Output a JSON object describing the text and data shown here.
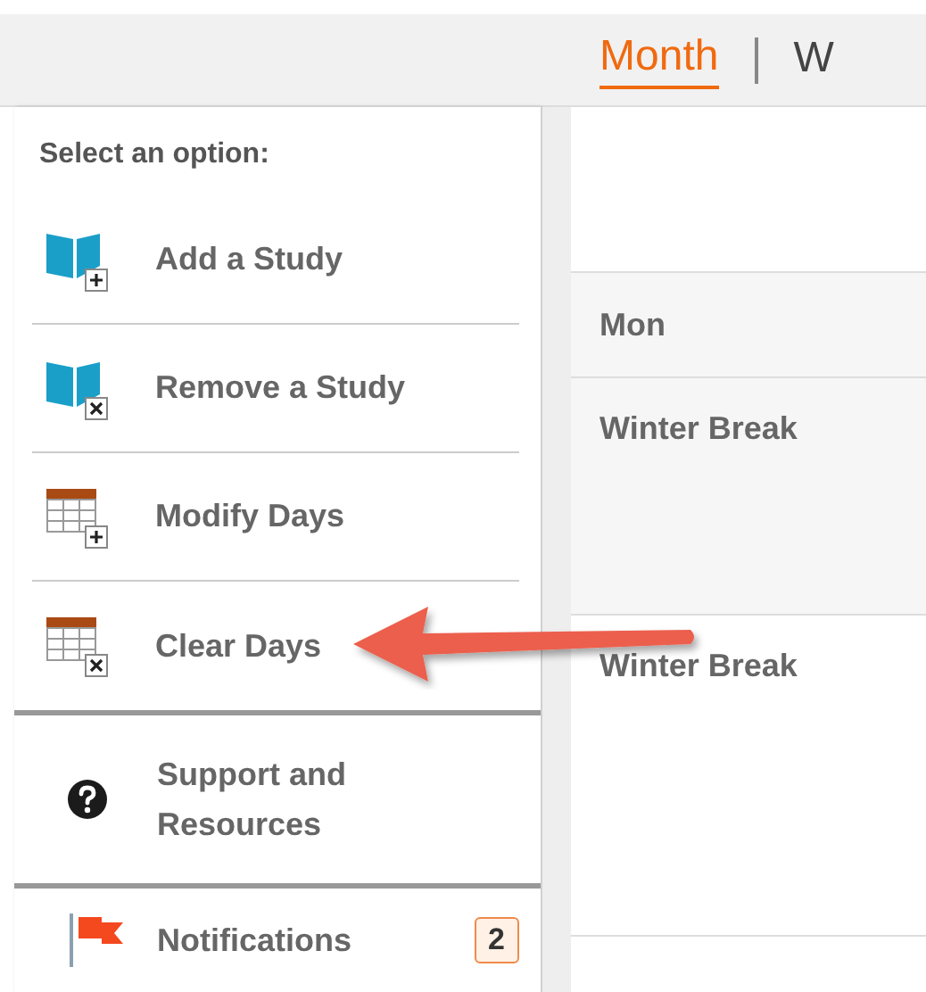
{
  "view_tabs": [
    {
      "label": "Month",
      "selected": true
    },
    {
      "label": "W",
      "selected": false
    }
  ],
  "sidebar": {
    "heading": "Select an option:",
    "items": [
      {
        "kind": "book-add",
        "label": "Add a Study"
      },
      {
        "kind": "book-remove",
        "label": "Remove a Study"
      },
      {
        "kind": "table-add",
        "label": "Modify Days"
      },
      {
        "kind": "table-remove",
        "label": "Clear Days"
      }
    ],
    "support": {
      "label": "Support and Resources"
    },
    "notifications": {
      "label": "Notifications",
      "count": "2"
    }
  },
  "calendar": {
    "day_header": "Mon",
    "cells": [
      {
        "text": "Winter Break",
        "shaded": true
      },
      {
        "text": "Winter Break",
        "shaded": false
      }
    ]
  },
  "annotation": {
    "kind": "arrow"
  }
}
